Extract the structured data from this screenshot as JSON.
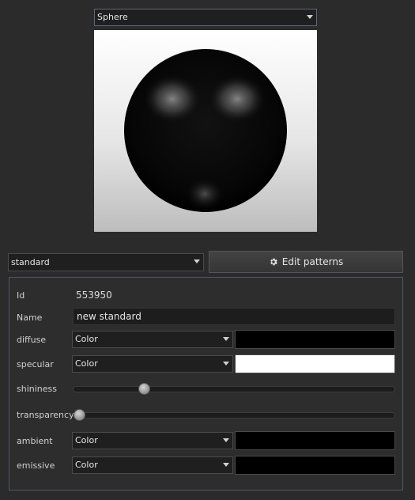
{
  "preview": {
    "shape": "Sphere"
  },
  "material": {
    "selected": "standard",
    "edit_patterns_label": "Edit patterns"
  },
  "props": {
    "id_label": "Id",
    "id_value": "553950",
    "name_label": "Name",
    "name_value": "new standard",
    "diffuse": {
      "label": "diffuse",
      "mode": "Color",
      "color": "#000000"
    },
    "specular": {
      "label": "specular",
      "mode": "Color",
      "color": "#ffffff"
    },
    "shininess": {
      "label": "shininess",
      "value": 0.21
    },
    "transparency": {
      "label": "transparency",
      "value": 0.0
    },
    "ambient": {
      "label": "ambient",
      "mode": "Color",
      "color": "#000000"
    },
    "emissive": {
      "label": "emissive",
      "mode": "Color",
      "color": "#000000"
    }
  },
  "icons": {
    "edit_patterns": "gear-icon",
    "dropdowns": "chevron-down-icon"
  },
  "colors": {
    "background": "#2b2b2b",
    "panel_border": "#4a5968"
  }
}
